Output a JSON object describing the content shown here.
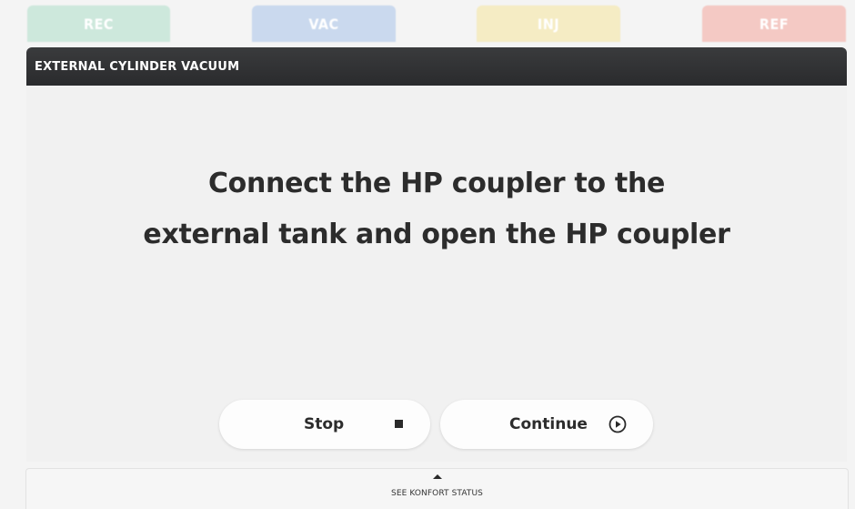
{
  "tabs": {
    "rec": "REC",
    "vac": "VAC",
    "inj": "INJ",
    "ref": "REF"
  },
  "panel": {
    "title": "EXTERNAL CYLINDER VACUUM",
    "instruction_line1": "Connect the HP coupler to the",
    "instruction_line2": "external tank and open the HP coupler"
  },
  "buttons": {
    "stop_label": "Stop",
    "stop_icon": "stop-square-icon",
    "continue_label": "Continue",
    "continue_icon": "play-circle-icon"
  },
  "status_bar": {
    "label": "SEE KONFORT STATUS",
    "icon": "caret-up-icon"
  },
  "colors": {
    "rec_tab": "#cde8dc",
    "vac_tab": "#cad9ee",
    "inj_tab": "#f5ecc4",
    "ref_tab": "#f4c9c4",
    "header": "#2e2f31"
  }
}
